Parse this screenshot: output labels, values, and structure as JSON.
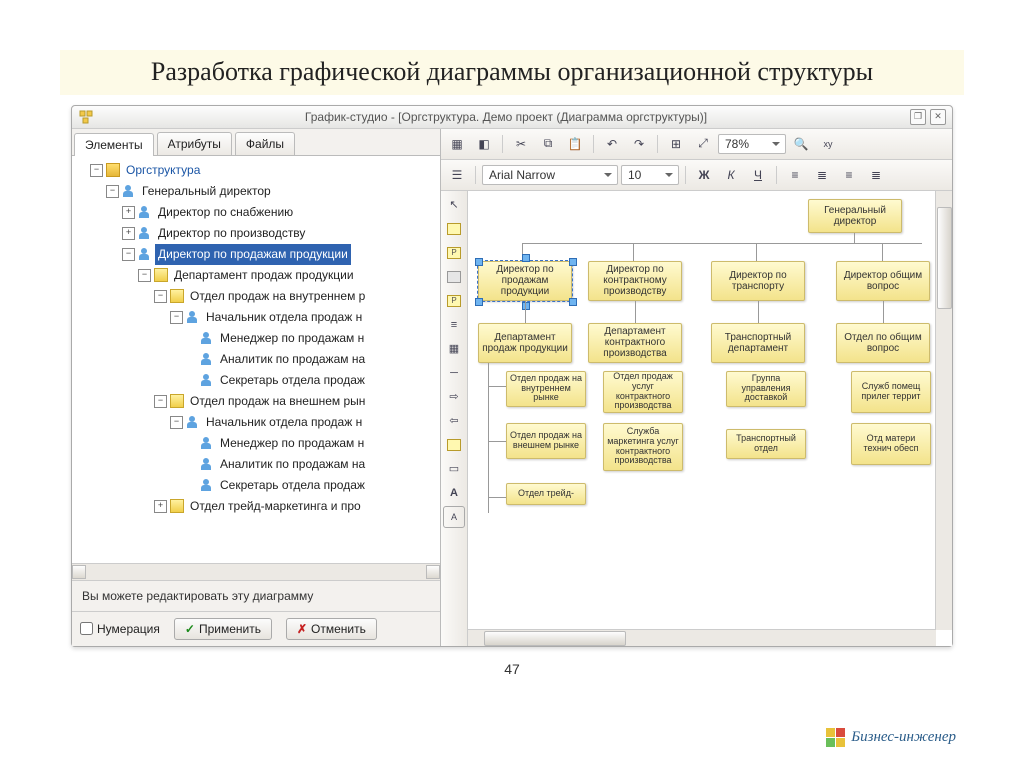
{
  "slide_title": "Разработка графической диаграммы организационной структуры",
  "page_number": "47",
  "footer_brand": "Бизнес-инженер",
  "window": {
    "title": "График-студио - [Оргструктура. Демо проект (Диаграмма оргструктуры)]"
  },
  "tabs": [
    "Элементы",
    "Атрибуты",
    "Файлы"
  ],
  "tree": {
    "root": "Оргструктура",
    "n1": "Генеральный директор",
    "n1_1": "Директор по снабжению",
    "n1_2": "Директор по производству",
    "n1_3": "Директор по продажам продукции",
    "n1_3_1": "Департамент продаж продукции",
    "n1_3_1_1": "Отдел продаж на внутреннем р",
    "n1_3_1_1_1": "Начальник отдела продаж н",
    "n1_3_1_1_1_1": "Менеджер по продажам н",
    "n1_3_1_1_1_2": "Аналитик по продажам на",
    "n1_3_1_1_1_3": "Секретарь отдела продаж",
    "n1_3_1_2": "Отдел продаж на внешнем рын",
    "n1_3_1_2_1": "Начальник отдела продаж н",
    "n1_3_1_2_1_1": "Менеджер по продажам н",
    "n1_3_1_2_1_2": "Аналитик по продажам на",
    "n1_3_1_2_1_3": "Секретарь отдела продаж",
    "n1_3_1_3": "Отдел трейд-маркетинга и про"
  },
  "status_text": "Вы можете редактировать эту диаграмму",
  "buttons": {
    "numbering": "Нумерация",
    "apply": "Применить",
    "cancel": "Отменить"
  },
  "toolbar": {
    "font": "Arial Narrow",
    "fontsize": "10",
    "zoom": "78%"
  },
  "format_btns": {
    "bold": "Ж",
    "italic": "К",
    "underline": "Ч"
  },
  "nodes": {
    "top": "Генеральный директор",
    "r1_1": "Директор по продажам продукции",
    "r1_2": "Директор по контрактному производству",
    "r1_3": "Директор по транспорту",
    "r1_4": "Директор общим вопрос",
    "r2_1": "Департамент продаж продукции",
    "r2_2": "Департамент контрактного производства",
    "r2_3": "Транспортный департамент",
    "r2_4": "Отдел по общим вопрос",
    "r3_1": "Отдел продаж на внутреннем рынке",
    "r3_2": "Отдел продаж услуг контрактного производства",
    "r3_3": "Группа управления доставкой",
    "r3_4": "Служб помещ прилег террит",
    "r4_1": "Отдел продаж на внешнем рынке",
    "r4_2": "Служба маркетинга услуг контрактного производства",
    "r4_3": "Транспортный отдел",
    "r4_4": "Отд матери технич обесп",
    "r5_1": "Отдел трейд-"
  }
}
